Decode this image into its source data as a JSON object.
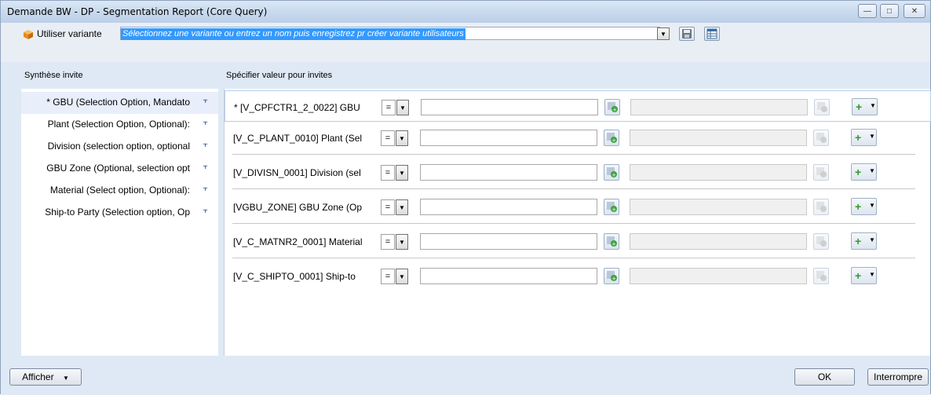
{
  "window": {
    "title": "Demande BW - DP - Segmentation Report (Core Query)",
    "controls": [
      "minimize",
      "maximize",
      "close"
    ]
  },
  "variant": {
    "label": "Utiliser variante",
    "placeholder": "Sélectionnez une variante ou entrez un nom puis enregistrez pr créer variante utilisateurs",
    "icon": "cube-icon"
  },
  "left_panel": {
    "header": "Synthèse invite",
    "items": [
      {
        "label": "* GBU (Selection Option, Mandato"
      },
      {
        "label": "Plant (Selection Option, Optional):"
      },
      {
        "label": "Division (selection option, optional"
      },
      {
        "label": "GBU Zone (Optional, selection opt"
      },
      {
        "label": "Material (Select option, Optional):"
      },
      {
        "label": "Ship-to Party (Selection option, Op"
      }
    ]
  },
  "right_panel": {
    "header": "Spécifier valeur pour invites",
    "rows": [
      {
        "name": "* [V_CPFCTR1_2_0022] GBU",
        "operator": "="
      },
      {
        "name": "[V_C_PLANT_0010]  Plant (Sel",
        "operator": "="
      },
      {
        "name": "[V_DIVISN_0001]  Division (sel",
        "operator": "="
      },
      {
        "name": "[VGBU_ZONE]  GBU  Zone (Op",
        "operator": "="
      },
      {
        "name": "[V_C_MATNR2_0001] Material",
        "operator": "="
      },
      {
        "name": "[V_C_SHIPTO_0001] Ship-to",
        "operator": "="
      }
    ]
  },
  "footer": {
    "show_label": "Afficher",
    "ok_label": "OK",
    "cancel_label": "Interrompre"
  },
  "colors": {
    "accent_selection": "#3399ff",
    "plus_green": "#2f9a2f",
    "cube_orange": "#f0a030"
  }
}
